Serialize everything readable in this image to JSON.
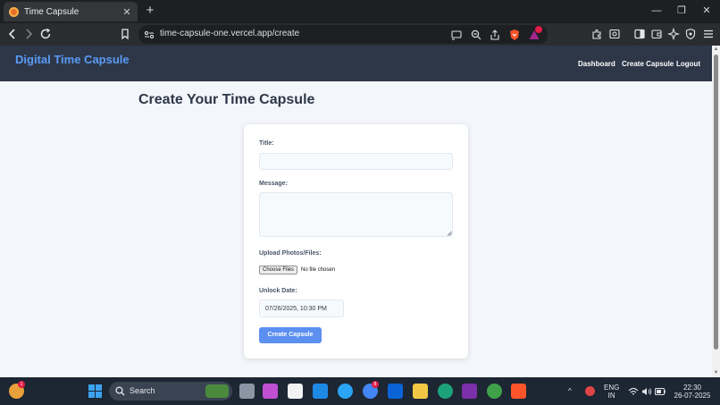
{
  "browser": {
    "tab_title": "Time Capsule",
    "tab_close": "✕",
    "new_tab": "+",
    "window_controls": [
      "—",
      "❐",
      "✕"
    ],
    "url": "time-capsule-one.vercel.app/create"
  },
  "site": {
    "brand": "Digital Time Capsule",
    "nav": [
      "Dashboard",
      "Create Capsule",
      "Logout"
    ]
  },
  "form": {
    "page_title": "Create Your Time Capsule",
    "title_label": "Title:",
    "title_value": "",
    "message_label": "Message:",
    "message_value": "",
    "upload_label": "Upload Photos/Files:",
    "choose_files": "Choose Files",
    "no_file": "No file chosen",
    "unlock_label": "Unlock Date:",
    "unlock_value": "07/26/2025, 10:30 PM",
    "submit": "Create Capsule"
  },
  "taskbar": {
    "search": "Search",
    "lang_top": "ENG",
    "lang_bottom": "IN",
    "time": "22:30",
    "date": "26-07-2025",
    "weather_badge": "1",
    "chrome_badge": "8"
  },
  "colors": {
    "header_bg": "#2d3748",
    "brand": "#5b9bf5",
    "button": "#5b8ff0",
    "page_bg": "#f3f6fa"
  }
}
